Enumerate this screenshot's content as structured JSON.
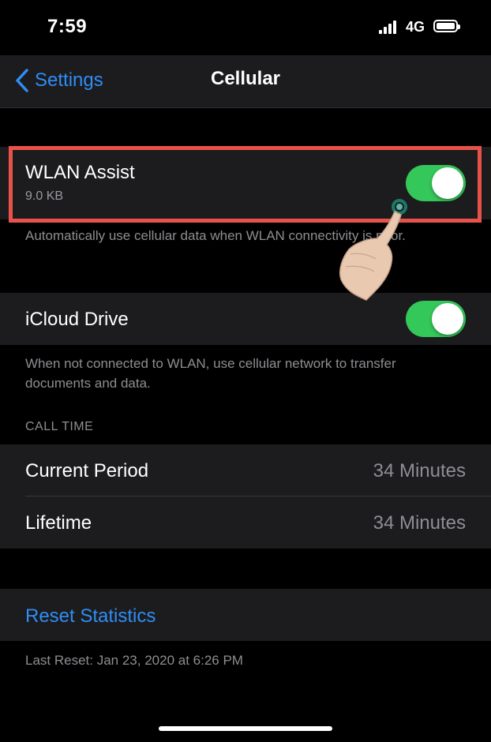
{
  "status_bar": {
    "time": "7:59",
    "network": "4G"
  },
  "nav": {
    "back_label": "Settings",
    "title": "Cellular"
  },
  "wlan_assist": {
    "title": "WLAN Assist",
    "usage": "9.0 KB",
    "enabled": true,
    "footer": "Automatically use cellular data when WLAN connectivity is poor."
  },
  "icloud_drive": {
    "title": "iCloud Drive",
    "enabled": true,
    "footer": "When not connected to WLAN, use cellular network to transfer documents and data."
  },
  "call_time": {
    "header": "CALL TIME",
    "rows": [
      {
        "label": "Current Period",
        "value": "34 Minutes"
      },
      {
        "label": "Lifetime",
        "value": "34 Minutes"
      }
    ]
  },
  "reset": {
    "label": "Reset Statistics",
    "last_reset": "Last Reset: Jan 23, 2020 at 6:26 PM"
  },
  "colors": {
    "accent": "#2f8df5",
    "toggle_on": "#34c759",
    "highlight": "#e9524a"
  }
}
